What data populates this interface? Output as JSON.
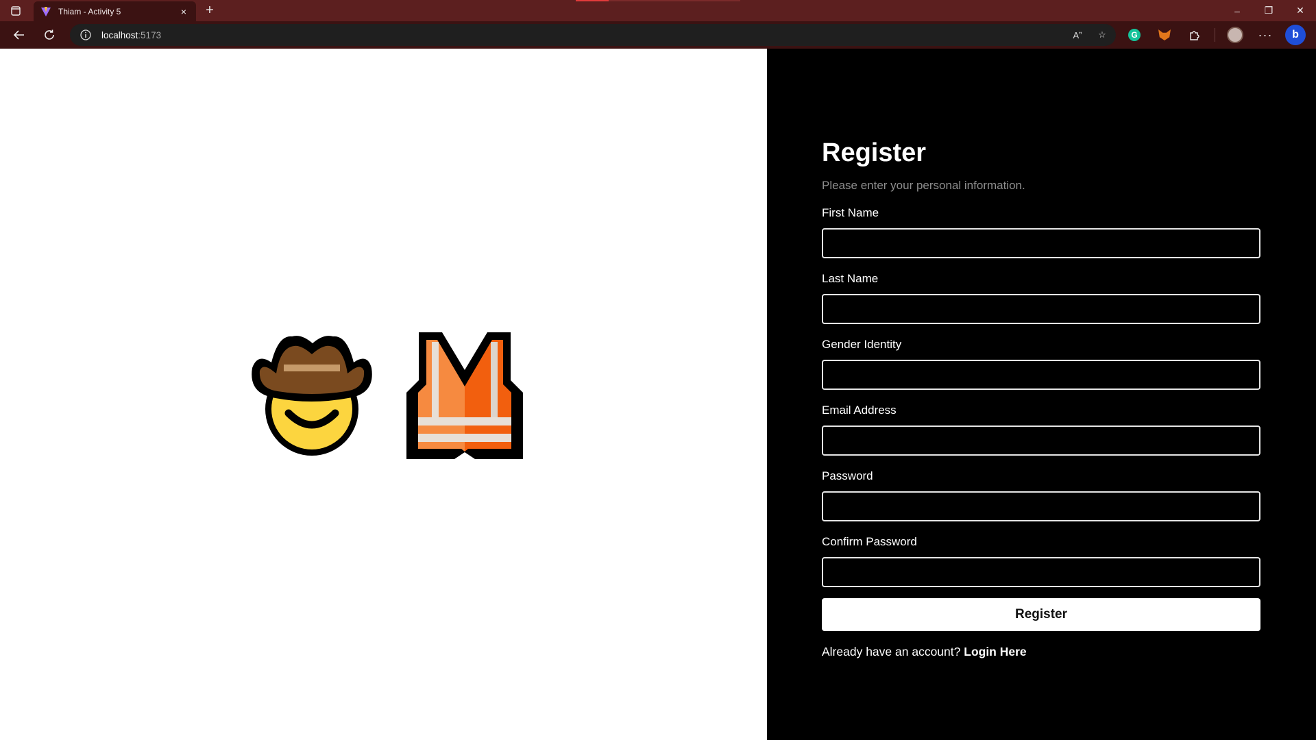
{
  "browser": {
    "tab": {
      "title": "Thiam - Activity 5",
      "close": "×"
    },
    "new_tab": "+",
    "address": {
      "host": "localhost",
      "port": ":5173"
    },
    "address_icons": {
      "read_aloud": "Aˮ",
      "favorite": "☆"
    },
    "window_controls": {
      "minimize": "–",
      "restore": "❐",
      "close": "✕"
    },
    "menu": "···",
    "grammarly": "G",
    "bing": "b"
  },
  "hero": {
    "emojis": [
      "cowboy-face",
      "safety-vest"
    ]
  },
  "form": {
    "title": "Register",
    "subtitle": "Please enter your personal information.",
    "fields": [
      {
        "label": "First Name",
        "value": ""
      },
      {
        "label": "Last Name",
        "value": ""
      },
      {
        "label": "Gender Identity",
        "value": ""
      },
      {
        "label": "Email Address",
        "value": ""
      },
      {
        "label": "Password",
        "value": ""
      },
      {
        "label": "Confirm Password",
        "value": ""
      }
    ],
    "submit_label": "Register",
    "login_prompt": "Already have an account?",
    "login_link": "Login Here"
  },
  "colors": {
    "tabbar": "#5c1f1f",
    "toolbar": "#3b1212",
    "form_panel": "#000000",
    "hero_panel": "#ffffff"
  }
}
